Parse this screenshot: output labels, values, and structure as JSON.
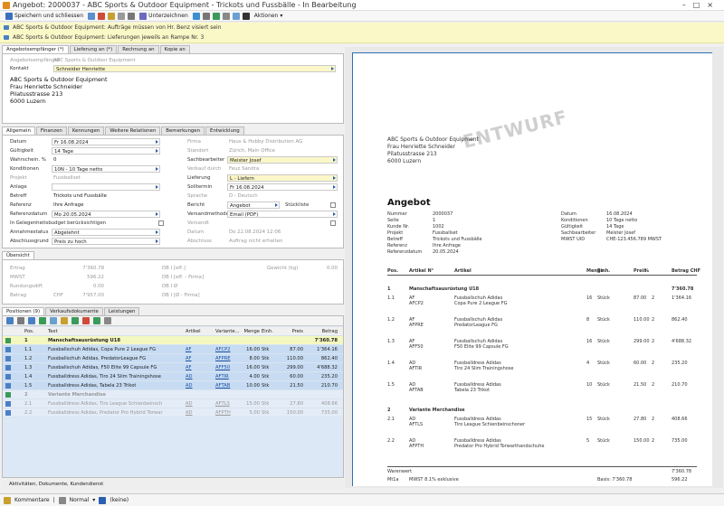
{
  "window": {
    "title": "Angebot: 2000037 - ABC Sports & Outdoor Equipment - Trickots und Fussbälle - In Bearbeitung"
  },
  "toolbar": {
    "save_close": "Speichern und schliessen",
    "sign": "Unterzeichnen",
    "actions": "Aktionen"
  },
  "notes": [
    "ABC Sports & Outdoor Equipment: Aufträge müssen von Hr. Benz visiert sein",
    "ABC Sports & Outdoor Equipment: Lieferungen jeweils an Rampe Nr. 3"
  ],
  "recipient": {
    "tabs": [
      "Angebotsempfänger (*)",
      "Lieferung an (*)",
      "Rechnung an",
      "Kopie an"
    ],
    "label_recipient": "Angebotsempfänger",
    "value_recipient": "ABC Sports & Outdoor Equipment",
    "label_contact": "Kontakt",
    "value_contact": "Schneider Henriette",
    "address": [
      "ABC Sports & Outdoor Equipment",
      "Frau Henriette Schneider",
      "Pilatusstrasse 213",
      "6000 Luzern"
    ]
  },
  "general": {
    "tabs": [
      "Allgemein",
      "Finanzen",
      "Kennungen",
      "Weitere Relationen",
      "Bemerkungen",
      "Entwicklung"
    ],
    "left": [
      {
        "label": "Datum",
        "value": "Fr 16.08.2024"
      },
      {
        "label": "Gültigkeit",
        "value": "14 Tage"
      },
      {
        "label": "Wahrschein. %",
        "value": "0"
      },
      {
        "label": "Konditionen",
        "value": "10N - 10 Tage netto"
      },
      {
        "label": "Projekt",
        "value": "Fussballset"
      },
      {
        "label": "Anlage",
        "value": ""
      },
      {
        "label": "Betreff",
        "value": "Trickots und Fussbälle"
      },
      {
        "label": "Referenz",
        "value": "Ihre Anfrage"
      },
      {
        "label": "Referenzdatum",
        "value": "Mo 20.05.2024"
      },
      {
        "label": "In Gelegenheitsbudget berücksichtigen",
        "value": ""
      },
      {
        "label": "Annahmestatus",
        "value": "Abgelehnt"
      },
      {
        "label": "Abschlussgrund",
        "value": "Preis zu hoch"
      }
    ],
    "right": [
      {
        "label": "Firma",
        "value": "Haus & Hobby Distribution AG"
      },
      {
        "label": "Standort",
        "value": "Zürich, Main Office"
      },
      {
        "label": "Sachbearbeiter",
        "value": "Meister Josef"
      },
      {
        "label": "Verkauf durch",
        "value": "Feuz Sandra"
      },
      {
        "label": "Lieferung",
        "value": "L - Liefern"
      },
      {
        "label": "Solltermin",
        "value": "Fr 16.08.2024"
      },
      {
        "label": "Sprache",
        "value": "D - Deutsch"
      },
      {
        "label": "Bericht",
        "value": "Angebot"
      },
      {
        "label": "Versandmethode",
        "value": "Email (PDF)"
      },
      {
        "label": "Versandt",
        "value": ""
      },
      {
        "label": "Datum",
        "value": "Do 22.08.2024 12:06"
      },
      {
        "label": "Abschluss",
        "value": "Auftrag nicht erhalten"
      }
    ],
    "extra_label": "Stückliste"
  },
  "overview": {
    "title": "Übersicht",
    "rows": [
      {
        "l": "Ertrag",
        "v": "7'360.78",
        "m": "DB I [eff.]",
        "r": "Gewicht (kg)",
        "rv": "0.00"
      },
      {
        "l": "MWST",
        "v": "596.22",
        "m": "DB I [eff. - Firma]",
        "r": "",
        "rv": ""
      },
      {
        "l": "Rundungsdiff.",
        "v": "0.00",
        "m": "DB I Ø",
        "r": "",
        "rv": ""
      },
      {
        "l": "Betrag",
        "cur": "CHF",
        "v": "7'957.00",
        "m": "DB I [Ø - Firma]",
        "r": "",
        "rv": ""
      }
    ]
  },
  "positions": {
    "tabs": [
      "Positionen (9)",
      "Verkaufsdokumente",
      "Leistungen"
    ],
    "headers": [
      "Pos.",
      "Text",
      "Artikel N°",
      "Variante...",
      "Menge",
      "Einh.",
      "Preis",
      "Betrag"
    ],
    "rows": [
      {
        "pos": "1",
        "text": "Manschaftsausrüstung U18",
        "art": "",
        "var": "",
        "qty": "",
        "unit": "",
        "price": "",
        "amount": "7'360.78",
        "type": "group"
      },
      {
        "pos": "1.1",
        "text": "Fussballschuh Adidas, Copa Pure 2 League FG",
        "art": "AF",
        "var": "AFCP2",
        "qty": "16.00",
        "unit": "Stk",
        "price": "87.00",
        "amount": "1'364.16",
        "type": "sel"
      },
      {
        "pos": "1.2",
        "text": "Fussballschuh Adidas, PredatorLeague FG",
        "art": "AF",
        "var": "AFPRE",
        "qty": "8.00",
        "unit": "Stk",
        "price": "110.00",
        "amount": "862.40",
        "type": "sel"
      },
      {
        "pos": "1.3",
        "text": "Fussballschuh Adidas, F50 Elite 99 Capsule FG",
        "art": "AF",
        "var": "AFF50",
        "qty": "16.00",
        "unit": "Stk",
        "price": "299.00",
        "amount": "4'688.32",
        "type": "sel"
      },
      {
        "pos": "1.4",
        "text": "Fussballdress Adidas, Tiro 24 Slim Trainingshose",
        "art": "AD",
        "var": "AFTIR",
        "qty": "4.00",
        "unit": "Stk",
        "price": "60.00",
        "amount": "235.20",
        "type": "sel"
      },
      {
        "pos": "1.5",
        "text": "Fussballdress Adidas, Tabela 23 Trikot",
        "art": "AD",
        "var": "AFTAB",
        "qty": "10.00",
        "unit": "Stk",
        "price": "21.50",
        "amount": "210.70",
        "type": "sel"
      },
      {
        "pos": "2",
        "text": "Variante Merchandise",
        "art": "",
        "var": "",
        "qty": "",
        "unit": "",
        "price": "",
        "amount": "",
        "type": "grayg"
      },
      {
        "pos": "2.1",
        "text": "Fussballdress Adidas, Tiro League Schienbeinsch",
        "art": "AD",
        "var": "AFTLS",
        "qty": "15.00",
        "unit": "Stk",
        "price": "27.80",
        "amount": "408.66",
        "type": "gray"
      },
      {
        "pos": "2.2",
        "text": "Fussballdress Adidas, Predator Pro Hybrid Torwar",
        "art": "AD",
        "var": "AFPTH",
        "qty": "5.00",
        "unit": "Stk",
        "price": "150.00",
        "amount": "735.00",
        "type": "gray"
      }
    ]
  },
  "bottom_tab": "Aktivitäten, Dokumente, Kundendienst",
  "statusbar": {
    "comment": "Kommentare",
    "normal": "Normal",
    "none": "(keine)"
  },
  "document": {
    "watermark": "ENTWURF",
    "sender_address": [
      "ABC Sports & Outdoor Equipment",
      "Frau Henriette Schneider",
      "Pilatusstrasse 213",
      "6000 Luzern"
    ],
    "heading": "Angebot",
    "meta_left": [
      [
        "Nummer",
        "2000037"
      ],
      [
        "Seite",
        "1"
      ],
      [
        "Kunde Nr.",
        "1002"
      ],
      [
        "Projekt",
        "Fussballset"
      ],
      [
        "Betreff",
        "Trickots und Fussbälle"
      ],
      [
        "Referenz",
        "Ihre Anfrage"
      ],
      [
        "Referenzdatum",
        "20.05.2024"
      ]
    ],
    "meta_right": [
      [
        "Datum",
        "16.08.2024"
      ],
      [
        "Konditionen",
        "10 Tage netto"
      ],
      [
        "Gültigkeit",
        "14 Tage"
      ],
      [
        "Sachbearbeiter",
        "Meister Josef"
      ],
      [
        "MWST UID",
        "CHE-123.456.789 MWST"
      ]
    ],
    "headers": [
      "Pos.",
      "Artikel N°",
      "Artikel",
      "Menge",
      "Einh.",
      "Preis",
      "%",
      "Betrag CHF"
    ],
    "group1": {
      "pos": "1",
      "name": "Manschaftsausrüstung U18",
      "amount": "7'360.78"
    },
    "items1": [
      {
        "pos": "1.1",
        "a1": "AF",
        "a2": "AFCP2",
        "t1": "Fussballschuh Adidas",
        "t2": "Copa Pure 2 League FG",
        "qty": "16",
        "unit": "Stück",
        "price": "87.00",
        "pct": "2",
        "amount": "1'364.16"
      },
      {
        "pos": "1.2",
        "a1": "AF",
        "a2": "AFPRE",
        "t1": "Fussballschuh Adidas",
        "t2": "PredatorLeague FG",
        "qty": "8",
        "unit": "Stück",
        "price": "110.00",
        "pct": "2",
        "amount": "862.40"
      },
      {
        "pos": "1.3",
        "a1": "AF",
        "a2": "AFF50",
        "t1": "Fussballschuh Adidas",
        "t2": "F50 Elite 99 Capsule FG",
        "qty": "16",
        "unit": "Stück",
        "price": "299.00",
        "pct": "2",
        "amount": "4'688.32"
      },
      {
        "pos": "1.4",
        "a1": "AD",
        "a2": "AFTIR",
        "t1": "Fussballdress Adidas",
        "t2": "Tiro 24 Slim Trainingshose",
        "qty": "4",
        "unit": "Stück",
        "price": "60.00",
        "pct": "2",
        "amount": "235.20"
      },
      {
        "pos": "1.5",
        "a1": "AD",
        "a2": "AFTAB",
        "t1": "Fussballdress Adidas",
        "t2": "Tabela 23 Trikot",
        "qty": "10",
        "unit": "Stück",
        "price": "21.50",
        "pct": "2",
        "amount": "210.70"
      }
    ],
    "group2": {
      "pos": "2",
      "name": "Variante Merchandise"
    },
    "items2": [
      {
        "pos": "2.1",
        "a1": "AD",
        "a2": "AFTLS",
        "t1": "Fussballdress Adidas",
        "t2": "Tiro League Schienbeinschoner",
        "qty": "15",
        "unit": "Stück",
        "price": "27.80",
        "pct": "2",
        "amount": "408.66"
      },
      {
        "pos": "2.2",
        "a1": "AD",
        "a2": "AFPTH",
        "t1": "Fussballdress Adidas",
        "t2": "Predator Pro Hybrid Torwarthandschuhe",
        "qty": "5",
        "unit": "Stück",
        "price": "150.00",
        "pct": "2",
        "amount": "735.00"
      }
    ],
    "warenwert_label": "Warenwert",
    "warenwert": "7'360.78",
    "mwst_label": "Mt1a",
    "mwst_text": "MWST 8.1% exklusive",
    "mwst_basis": "Basis: 7'360.78",
    "mwst": "596.22"
  }
}
